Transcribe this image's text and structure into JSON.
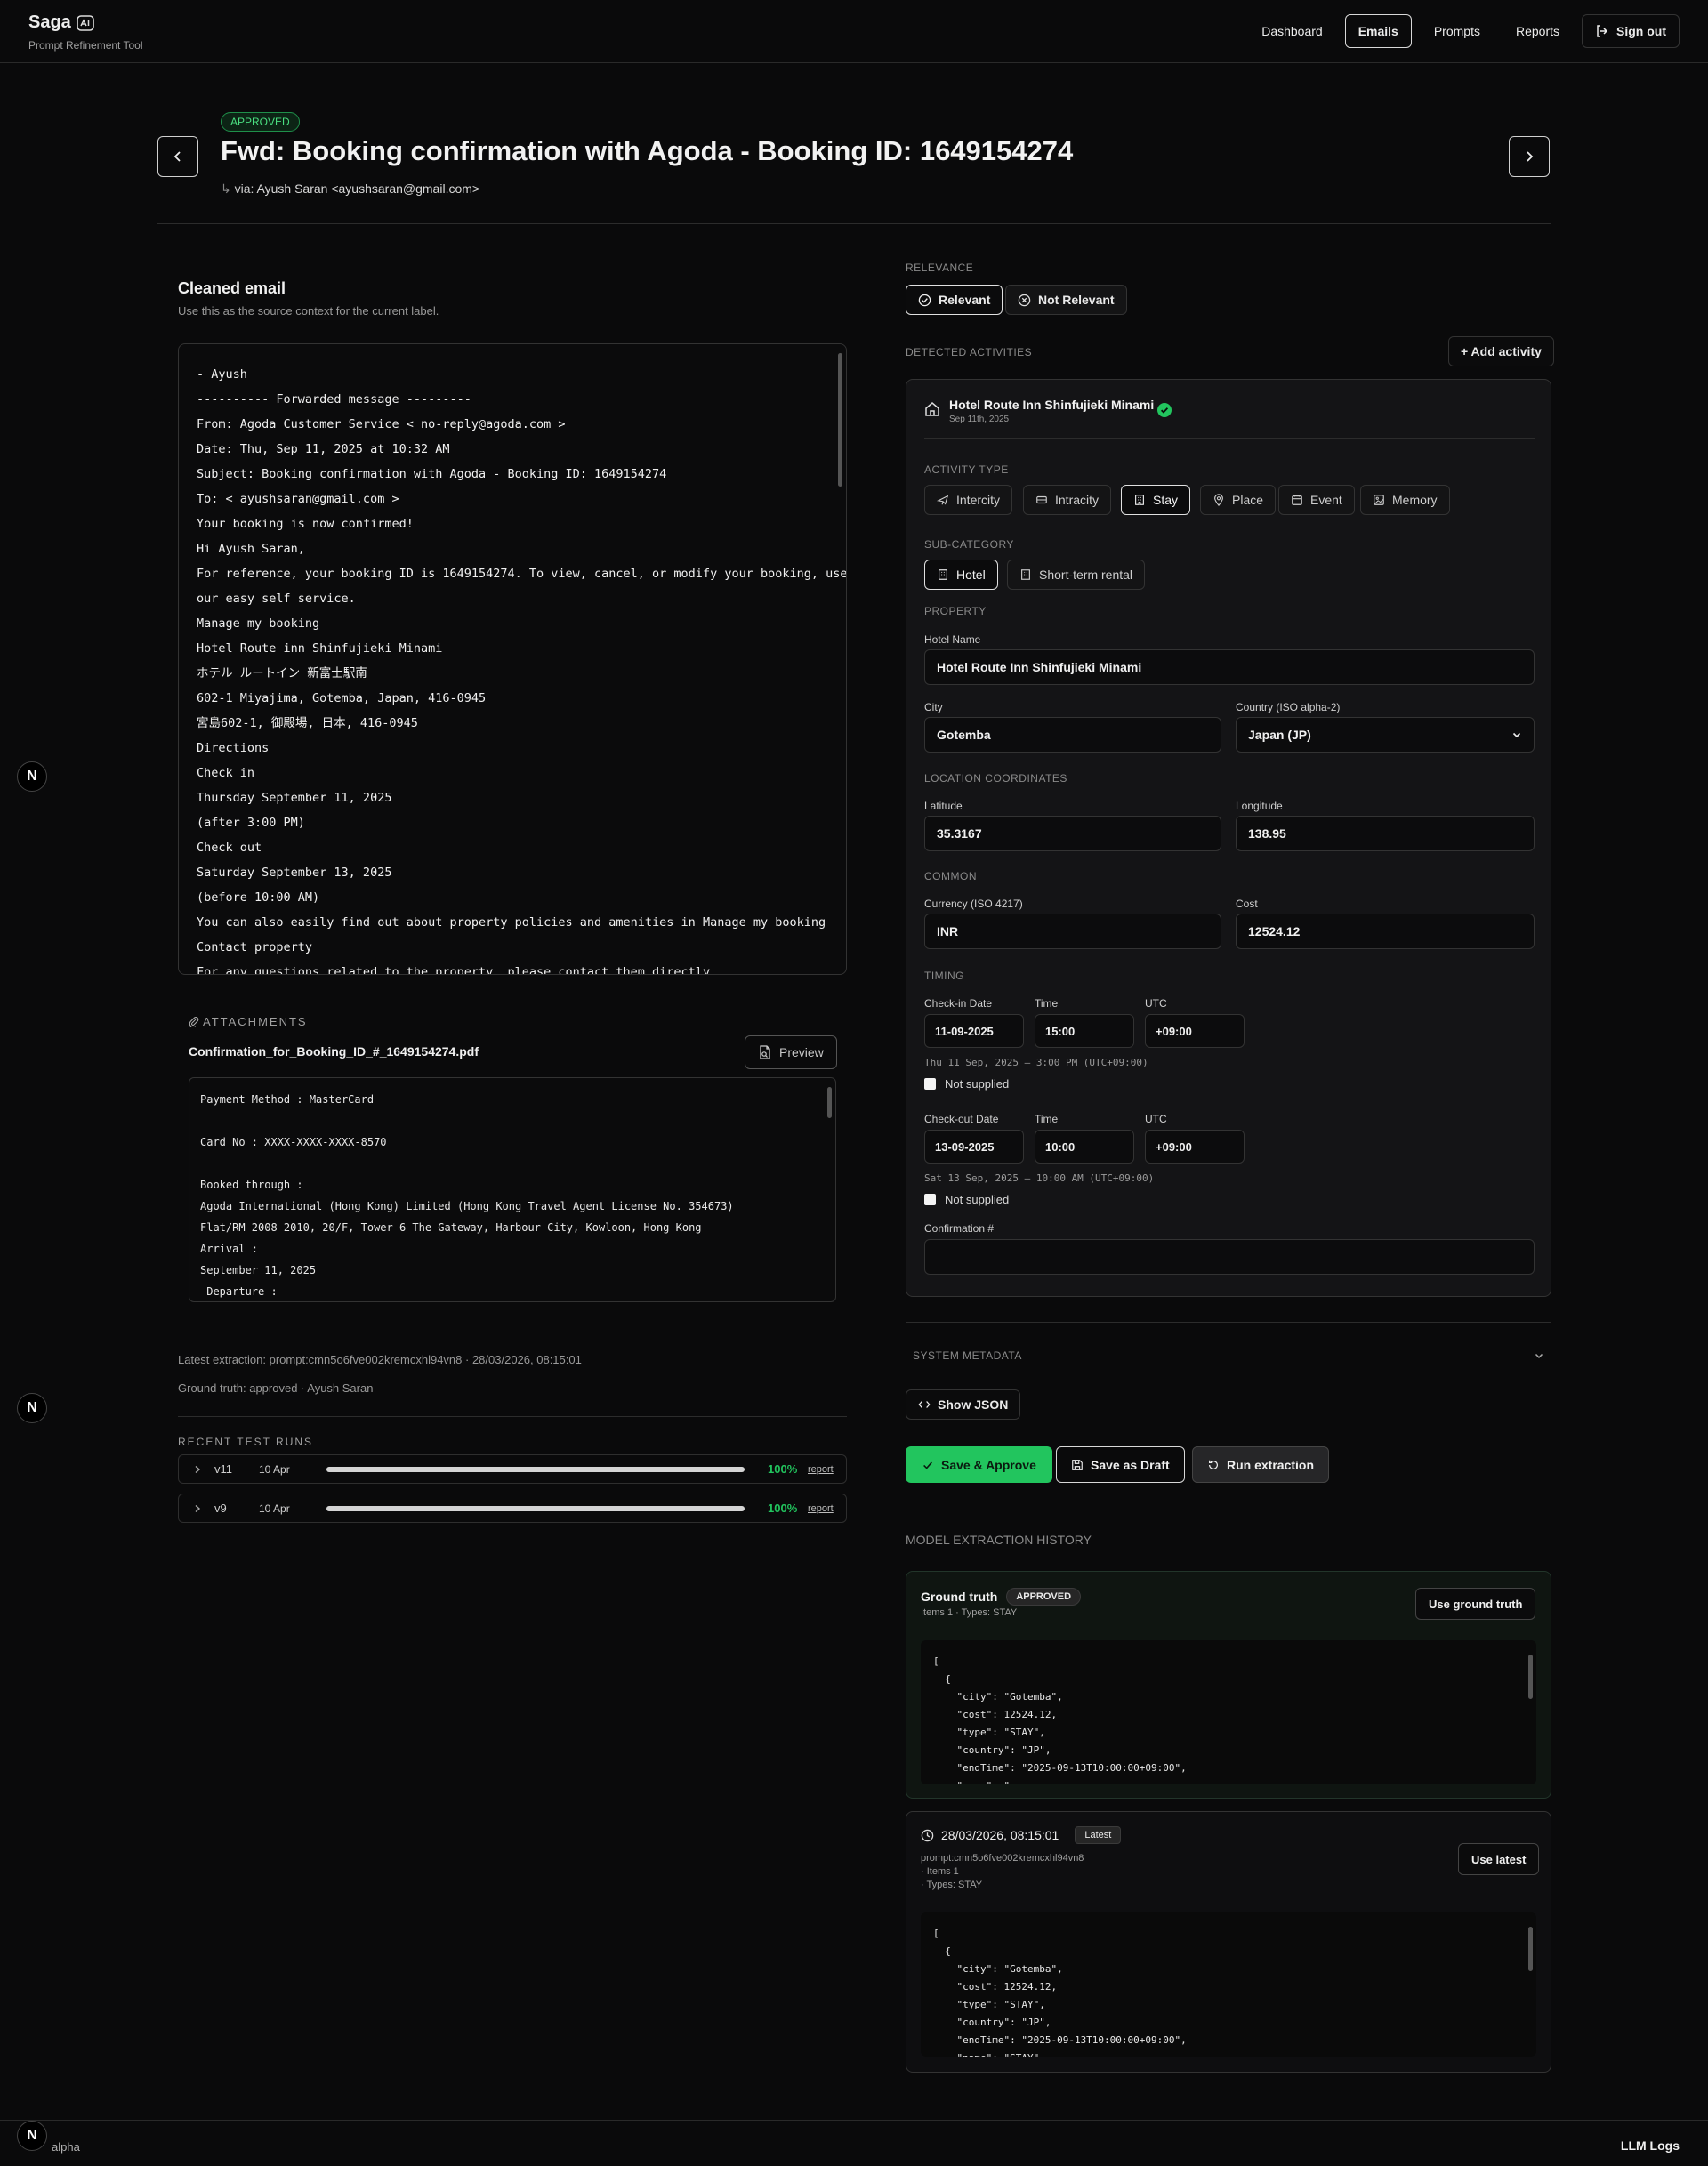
{
  "app": {
    "name": "Saga",
    "subtitle": "Prompt Refinement Tool"
  },
  "nav": {
    "dashboard": "Dashboard",
    "emails": "Emails",
    "prompts": "Prompts",
    "reports": "Reports",
    "sign_out": "Sign out"
  },
  "email": {
    "status": "APPROVED",
    "subject": "Fwd: Booking confirmation with Agoda - Booking ID: 1649154274",
    "via_label": "via:",
    "via_sender": "Ayush Saran <ayushsaran@gmail.com>"
  },
  "cleaned": {
    "title": "Cleaned email",
    "subtitle": "Use this as the source context for the current label.",
    "lines": [
      "- Ayush",
      "---------- Forwarded message ---------",
      "From: Agoda Customer Service < no-reply@agoda.com >",
      "Date: Thu, Sep 11, 2025 at 10:32 AM",
      "Subject: Booking confirmation with Agoda - Booking ID: 1649154274",
      "To: < ayushsaran@gmail.com >",
      "Your booking is now confirmed!",
      "Hi Ayush Saran,",
      "For reference, your booking ID is 1649154274. To view, cancel, or modify your booking, use",
      "our easy self service.",
      "Manage my booking",
      "Hotel Route inn Shinfujieki Minami",
      "ホテル ルートイン 新富士駅南",
      "602-1 Miyajima, Gotemba, Japan, 416-0945",
      "宮島602-1, 御殿場, 日本, 416-0945",
      "Directions",
      "Check in",
      "Thursday September 11, 2025",
      "(after 3:00 PM)",
      "Check out",
      "Saturday September 13, 2025",
      "(before 10:00 AM)",
      "You can also easily find out about property policies and amenities in Manage my booking",
      "Contact property",
      "For any questions related to the property, please contact them directly."
    ]
  },
  "attachments": {
    "label": "ATTACHMENTS",
    "filename": "Confirmation_for_Booking_ID_#_1649154274.pdf",
    "preview_label": "Preview",
    "lines": [
      "Payment Method : MasterCard",
      "",
      "Card No : XXXX-XXXX-XXXX-8570",
      "",
      "Booked through :",
      "Agoda International (Hong Kong) Limited (Hong Kong Travel Agent License No. 354673)",
      "Flat/RM 2008-2010, 20/F, Tower 6 The Gateway, Harbour City, Kowloon, Hong Kong",
      "Arrival :",
      "September 11, 2025",
      " Departure :"
    ]
  },
  "extraction_meta": {
    "latest": "Latest extraction: prompt:cmn5o6fve002kremcxhl94vn8 · 28/03/2026, 08:15:01",
    "ground_truth": "Ground truth: approved · Ayush Saran"
  },
  "test_runs": {
    "label": "RECENT TEST RUNS",
    "runs": [
      {
        "version": "v11",
        "date": "10 Apr",
        "percent_label": "100%",
        "progress": 1.0,
        "report": "report"
      },
      {
        "version": "v9",
        "date": "10 Apr",
        "percent_label": "100%",
        "progress": 1.0,
        "report": "report"
      }
    ]
  },
  "relevance": {
    "label": "RELEVANCE",
    "relevant": "Relevant",
    "not_relevant": "Not Relevant"
  },
  "activities": {
    "label": "DETECTED ACTIVITIES",
    "add_label": "+ Add activity"
  },
  "activity": {
    "name": "Hotel Route Inn Shinfujieki Minami",
    "date": "Sep 11th, 2025",
    "type_label": "ACTIVITY TYPE",
    "types": [
      "Intercity",
      "Intracity",
      "Stay",
      "Place",
      "Event",
      "Memory"
    ],
    "selected_type": "Stay",
    "subcat_label": "SUB-CATEGORY",
    "subcats": [
      "Hotel",
      "Short-term rental"
    ],
    "selected_subcat": "Hotel",
    "property_label": "PROPERTY",
    "hotel_name_label": "Hotel Name",
    "hotel_name": "Hotel Route Inn Shinfujieki Minami",
    "city_label": "City",
    "city": "Gotemba",
    "country_label": "Country (ISO alpha-2)",
    "country": "Japan (JP)",
    "coords_label": "LOCATION COORDINATES",
    "lat_label": "Latitude",
    "lat": "35.3167",
    "lon_label": "Longitude",
    "lon": "138.95",
    "common_label": "COMMON",
    "currency_label": "Currency (ISO 4217)",
    "currency": "INR",
    "cost_label": "Cost",
    "cost": "12524.12",
    "timing_label": "TIMING",
    "checkin_label": "Check-in Date",
    "checkin_date": "11-09-2025",
    "time_label": "Time",
    "checkin_time": "15:00",
    "utc_label": "UTC",
    "checkin_utc": "+09:00",
    "checkin_hint": "Thu 11 Sep, 2025 — 3:00 PM (UTC+09:00)",
    "not_supplied": "Not supplied",
    "checkout_label": "Check-out Date",
    "checkout_date": "13-09-2025",
    "checkout_time": "10:00",
    "checkout_utc": "+09:00",
    "checkout_hint": "Sat 13 Sep, 2025 — 10:00 AM (UTC+09:00)",
    "confirmation_label": "Confirmation #",
    "confirmation": ""
  },
  "system_meta": {
    "label": "SYSTEM METADATA",
    "show_json": "Show JSON"
  },
  "actions": {
    "save_approve": "Save & Approve",
    "save_draft": "Save as Draft",
    "run_extraction": "Run extraction"
  },
  "history": {
    "label": "MODEL EXTRACTION HISTORY",
    "ground_truth_title": "Ground truth",
    "ground_truth_tag": "APPROVED",
    "ground_truth_meta": "Items 1 · Types: STAY",
    "use_ground_truth": "Use ground truth",
    "gt_json": [
      "[",
      "  {",
      "    \"city\": \"Gotemba\",",
      "    \"cost\": 12524.12,",
      "    \"type\": \"STAY\",",
      "    \"country\": \"JP\",",
      "    \"endTime\": \"2025-09-13T10:00:00+09:00\",",
      "    \"name\": \"..."
    ],
    "latest_time": "28/03/2026, 08:15:01",
    "latest_tag": "Latest",
    "latest_prompt": "prompt:cmn5o6fve002kremcxhl94vn8",
    "latest_items": "· Items 1",
    "latest_types": "· Types: STAY",
    "use_latest": "Use latest",
    "latest_json": [
      "[",
      "  {",
      "    \"city\": \"Gotemba\",",
      "    \"cost\": 12524.12,",
      "    \"type\": \"STAY\",",
      "    \"country\": \"JP\",",
      "    \"endTime\": \"2025-09-13T10:00:00+09:00\",",
      "    \"name\": \"STAY\""
    ]
  },
  "footer": {
    "left": "alpha",
    "right": "LLM Logs",
    "n_badge": "N"
  },
  "colors": {
    "accent_green": "#22c55e",
    "approved_text": "#4ade80",
    "background": "#0a0a0b"
  }
}
